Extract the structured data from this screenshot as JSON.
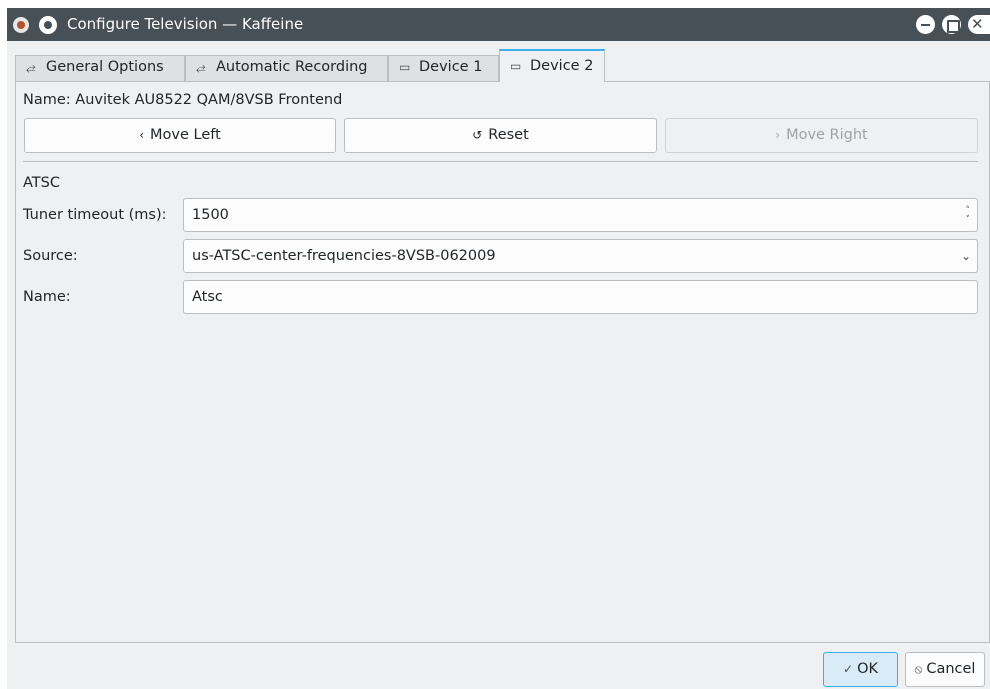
{
  "window": {
    "title": "Configure Television — Kaffeine",
    "close_glyph": "✕"
  },
  "tabs": [
    {
      "label": "General Options",
      "icon": "sliders-icon",
      "glyph": "⥄"
    },
    {
      "label": "Automatic Recording",
      "icon": "sliders-icon",
      "glyph": "⥄"
    },
    {
      "label": "Device 1",
      "icon": "monitor-icon",
      "glyph": "▭"
    },
    {
      "label": "Device 2",
      "icon": "monitor-icon",
      "glyph": "▭"
    }
  ],
  "device": {
    "name": "Name: Auvitek AU8522 QAM/8VSB Frontend",
    "move_left": "Move Left",
    "move_left_glyph": "‹",
    "reset": "Reset",
    "reset_glyph": "↺",
    "move_right": "Move Right",
    "move_right_glyph": "›"
  },
  "atsc": {
    "section": "ATSC",
    "timeout_label": "Tuner timeout (ms):",
    "timeout_value": "1500",
    "source_label": "Source:",
    "source_value": "us-ATSC-center-frequencies-8VSB-062009",
    "name_label": "Name:",
    "name_value": "Atsc",
    "spin_up": "˄",
    "spin_down": "˅",
    "dropdown": "⌄"
  },
  "dialog": {
    "ok": "OK",
    "ok_glyph": "✓",
    "cancel": "Cancel",
    "cancel_glyph": "⦸"
  },
  "colors": {
    "titlebar": "#475057",
    "accent": "#3daee9",
    "window": "#eff0f1"
  }
}
